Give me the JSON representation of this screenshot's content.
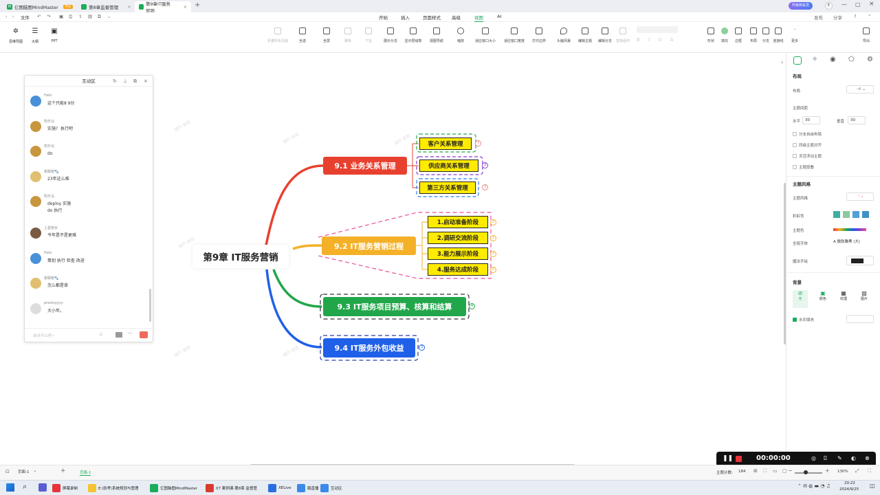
{
  "tabs": [
    {
      "label": "亿图脑图MindMaster",
      "badge": "Pro"
    },
    {
      "label": "第8章监督管理"
    },
    {
      "label": "第9章IT服务营销"
    }
  ],
  "top_right": {
    "upgrade": "升级到会员",
    "publish": "发布",
    "share": "分享"
  },
  "menu": {
    "file": "文件",
    "tabs": [
      "开始",
      "插入",
      "页面样式",
      "高级",
      "视图",
      "AI"
    ],
    "active": "视图"
  },
  "left_tools": [
    "思维导图",
    "大纲",
    "PPT"
  ],
  "toolbar": [
    "折叠所有页面",
    "全选",
    "全屏",
    "聚焦",
    "下钻",
    "展示分支",
    "显示层级数",
    "视图导航",
    "缩放",
    "适应窗口大小",
    "适应窗口宽度",
    "打印边界",
    "头脑风暴",
    "编辑主题",
    "编辑分支",
    "智能组件",
    "形状",
    "填充",
    "边框",
    "布局",
    "分支",
    "连接线",
    "更多",
    "导出"
  ],
  "chat": {
    "title": "互动区",
    "messages": [
      {
        "user": "Halo",
        "text": "这个只能8 9分"
      },
      {
        "user": "吹乐马",
        "text": "实施?  执行吧"
      },
      {
        "user": "吹乐马",
        "text": "do"
      },
      {
        "user": "谢谢谢🐾",
        "text": "23年这么难"
      },
      {
        "user": "吹乐马",
        "text": "deploy 实施\ndo 执行"
      },
      {
        "user": "上善若水",
        "text": "今年是不是更难"
      },
      {
        "user": "Halo",
        "text": "策划 执行 检查 改进"
      },
      {
        "user": "谢谢谢🐾",
        "text": "怎么都是背"
      },
      {
        "user": "prestoyyyy",
        "text": "大小年。"
      }
    ],
    "input_placeholder": "说点什么吧~",
    "colors": {
      "avatar1": "#4a90d9",
      "avatar2": "#c8963e",
      "avatar3": "#e0c070",
      "avatar4": "#7a5a40"
    }
  },
  "mindmap": {
    "root": "第9章 IT服务营销",
    "branches": [
      {
        "label": "9.1 业务关系管理",
        "color": "#e8402f",
        "children": [
          "客户关系管理",
          "供应商关系管理",
          "第三方关系管理"
        ],
        "count": "3"
      },
      {
        "label": "9.2 IT服务营销过程",
        "color": "#f4b128",
        "children": [
          "1.启动准备阶段",
          "2.调研交流阶段",
          "3.能力展示阶段",
          "4.服务达成阶段"
        ],
        "count": "2"
      },
      {
        "label": "9.3 IT服务项目预算、核算和结算",
        "color": "#22a64a",
        "children": [],
        "count": "4"
      },
      {
        "label": "9.4 IT服务外包收益",
        "color": "#2060e8",
        "children": [],
        "count": "3"
      }
    ],
    "watermark": "编作·者胜"
  },
  "right_panel": {
    "layout_title": "布局",
    "layout_label": "布局",
    "spacing_label": "主题间距",
    "horizontal_label": "水平",
    "horizontal_value": "30",
    "vertical_label": "垂直",
    "vertical_value": "30",
    "checks": [
      "分支自由布局",
      "同级主题对齐",
      "灵活浮动主题",
      "主题层叠"
    ],
    "style_title": "主题风格",
    "style_label": "主题风格",
    "rainbow_label": "彩虹色",
    "color_label": "主题色",
    "font_label": "全局字体",
    "font_value": "A 微软雅黑 (大)",
    "hand_label": "魔法手绘",
    "bg_title": "背景",
    "bg_options": [
      "无",
      "颜色",
      "纹理",
      "图片"
    ],
    "watermark_label": "水印填充"
  },
  "status": {
    "page": "页面-1",
    "page_tab": "页面-1",
    "topic_count_label": "主题计数:",
    "topic_count": "184",
    "zoom": "130%"
  },
  "recorder": {
    "time": "00:00:00"
  },
  "taskbar": {
    "items": [
      "屏幕录制",
      "E:\\软考\\系统规划与管理",
      "亿图脑图MindMaster",
      "07 案例课-第8章 监督管",
      "XELive",
      "鹅直播",
      "互动区"
    ],
    "time": "20:22",
    "date": "2024/9/25"
  }
}
